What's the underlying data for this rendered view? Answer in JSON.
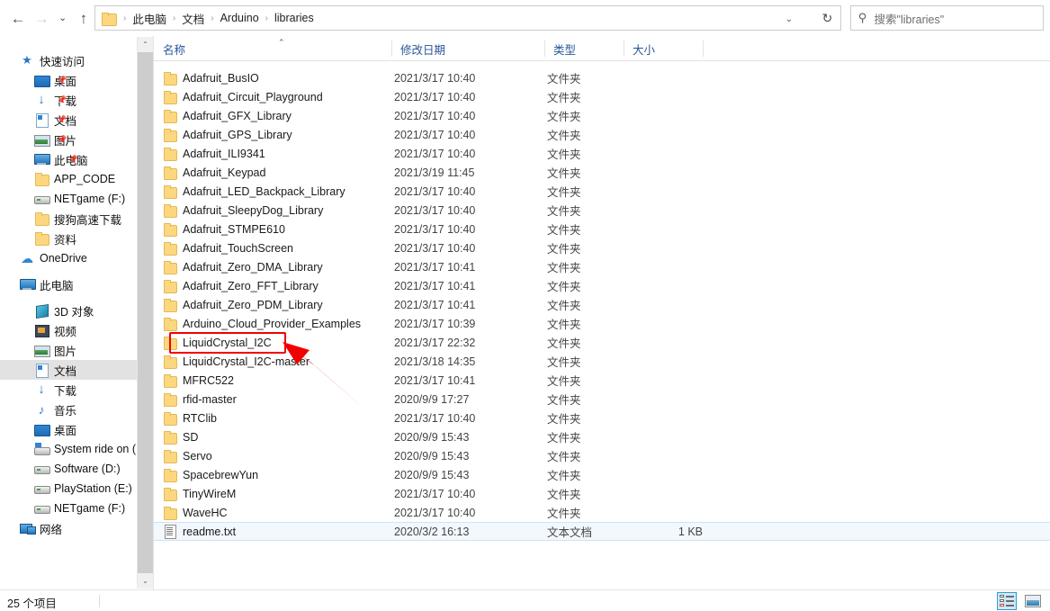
{
  "window": {
    "title": "libraries"
  },
  "nav": {
    "back_label": "←",
    "forward_label": "→",
    "recent_label": "⌄",
    "up_label": "↑"
  },
  "address": {
    "folder_icon": "folder-icon",
    "crumbs": [
      "此电脑",
      "文档",
      "Arduino",
      "libraries"
    ],
    "separator": "›",
    "dropdown_label": "⌄",
    "refresh_label": "↻"
  },
  "search": {
    "icon": "search-icon",
    "placeholder": "搜索\"libraries\""
  },
  "sidebar": {
    "items": [
      {
        "label": "快速访问",
        "icon": "star-icon",
        "level": 1,
        "pinned": false,
        "selected": false
      },
      {
        "label": "桌面",
        "icon": "desktop-icon",
        "level": 2,
        "pinned": true,
        "selected": false
      },
      {
        "label": "下载",
        "icon": "download-icon",
        "level": 2,
        "pinned": true,
        "selected": false
      },
      {
        "label": "文档",
        "icon": "document-icon",
        "level": 2,
        "pinned": true,
        "selected": false
      },
      {
        "label": "图片",
        "icon": "picture-icon",
        "level": 2,
        "pinned": true,
        "selected": false
      },
      {
        "label": "此电脑",
        "icon": "pc-icon",
        "level": 2,
        "pinned": true,
        "selected": false
      },
      {
        "label": "APP_CODE",
        "icon": "folder-icon",
        "level": 2,
        "pinned": false,
        "selected": false
      },
      {
        "label": "NETgame (F:)",
        "icon": "drive-icon",
        "level": 2,
        "pinned": false,
        "selected": false
      },
      {
        "label": "搜狗高速下载",
        "icon": "folder-icon",
        "level": 2,
        "pinned": false,
        "selected": false
      },
      {
        "label": "资料",
        "icon": "folder-icon",
        "level": 2,
        "pinned": false,
        "selected": false
      },
      {
        "label": "OneDrive",
        "icon": "onedrive-icon",
        "level": 1,
        "pinned": false,
        "selected": false
      },
      {
        "label": "此电脑",
        "icon": "pc-icon",
        "level": 1,
        "pinned": false,
        "selected": false
      },
      {
        "label": "3D 对象",
        "icon": "3d-object-icon",
        "level": 2,
        "pinned": false,
        "selected": false
      },
      {
        "label": "视频",
        "icon": "video-icon",
        "level": 2,
        "pinned": false,
        "selected": false
      },
      {
        "label": "图片",
        "icon": "picture-icon",
        "level": 2,
        "pinned": false,
        "selected": false
      },
      {
        "label": "文档",
        "icon": "document-icon",
        "level": 2,
        "pinned": false,
        "selected": true
      },
      {
        "label": "下载",
        "icon": "download-icon",
        "level": 2,
        "pinned": false,
        "selected": false
      },
      {
        "label": "音乐",
        "icon": "music-icon",
        "level": 2,
        "pinned": false,
        "selected": false
      },
      {
        "label": "桌面",
        "icon": "desktop-icon",
        "level": 2,
        "pinned": false,
        "selected": false
      },
      {
        "label": "System ride on (",
        "icon": "system-drive-icon",
        "level": 2,
        "pinned": false,
        "selected": false
      },
      {
        "label": "Software (D:)",
        "icon": "drive-icon",
        "level": 2,
        "pinned": false,
        "selected": false
      },
      {
        "label": "PlayStation (E:)",
        "icon": "drive-icon",
        "level": 2,
        "pinned": false,
        "selected": false
      },
      {
        "label": "NETgame (F:)",
        "icon": "drive-icon",
        "level": 2,
        "pinned": false,
        "selected": false
      },
      {
        "label": "网络",
        "icon": "network-icon",
        "level": 1,
        "pinned": false,
        "selected": false
      }
    ],
    "scroll_up": "⌃",
    "scroll_down": "⌄"
  },
  "filelist": {
    "columns": [
      {
        "label": "名称",
        "key": "name"
      },
      {
        "label": "修改日期",
        "key": "date"
      },
      {
        "label": "类型",
        "key": "type"
      },
      {
        "label": "大小",
        "key": "size"
      }
    ],
    "sort_indicator": "⌃",
    "sort_column": "名称",
    "sort_direction": "ascending",
    "rows": [
      {
        "name": "Adafruit_BusIO",
        "date": "2021/3/17 10:40",
        "type": "文件夹",
        "size": "",
        "icon": "folder-icon",
        "selected": false
      },
      {
        "name": "Adafruit_Circuit_Playground",
        "date": "2021/3/17 10:40",
        "type": "文件夹",
        "size": "",
        "icon": "folder-icon",
        "selected": false
      },
      {
        "name": "Adafruit_GFX_Library",
        "date": "2021/3/17 10:40",
        "type": "文件夹",
        "size": "",
        "icon": "folder-icon",
        "selected": false
      },
      {
        "name": "Adafruit_GPS_Library",
        "date": "2021/3/17 10:40",
        "type": "文件夹",
        "size": "",
        "icon": "folder-icon",
        "selected": false
      },
      {
        "name": "Adafruit_ILI9341",
        "date": "2021/3/17 10:40",
        "type": "文件夹",
        "size": "",
        "icon": "folder-icon",
        "selected": false
      },
      {
        "name": "Adafruit_Keypad",
        "date": "2021/3/19 11:45",
        "type": "文件夹",
        "size": "",
        "icon": "folder-icon",
        "selected": false
      },
      {
        "name": "Adafruit_LED_Backpack_Library",
        "date": "2021/3/17 10:40",
        "type": "文件夹",
        "size": "",
        "icon": "folder-icon",
        "selected": false
      },
      {
        "name": "Adafruit_SleepyDog_Library",
        "date": "2021/3/17 10:40",
        "type": "文件夹",
        "size": "",
        "icon": "folder-icon",
        "selected": false
      },
      {
        "name": "Adafruit_STMPE610",
        "date": "2021/3/17 10:40",
        "type": "文件夹",
        "size": "",
        "icon": "folder-icon",
        "selected": false
      },
      {
        "name": "Adafruit_TouchScreen",
        "date": "2021/3/17 10:40",
        "type": "文件夹",
        "size": "",
        "icon": "folder-icon",
        "selected": false
      },
      {
        "name": "Adafruit_Zero_DMA_Library",
        "date": "2021/3/17 10:41",
        "type": "文件夹",
        "size": "",
        "icon": "folder-icon",
        "selected": false
      },
      {
        "name": "Adafruit_Zero_FFT_Library",
        "date": "2021/3/17 10:41",
        "type": "文件夹",
        "size": "",
        "icon": "folder-icon",
        "selected": false
      },
      {
        "name": "Adafruit_Zero_PDM_Library",
        "date": "2021/3/17 10:41",
        "type": "文件夹",
        "size": "",
        "icon": "folder-icon",
        "selected": false
      },
      {
        "name": "Arduino_Cloud_Provider_Examples",
        "date": "2021/3/17 10:39",
        "type": "文件夹",
        "size": "",
        "icon": "folder-icon",
        "selected": false
      },
      {
        "name": "LiquidCrystal_I2C",
        "date": "2021/3/17 22:32",
        "type": "文件夹",
        "size": "",
        "icon": "folder-icon",
        "selected": false
      },
      {
        "name": "LiquidCrystal_I2C-master",
        "date": "2021/3/18 14:35",
        "type": "文件夹",
        "size": "",
        "icon": "folder-icon",
        "selected": false
      },
      {
        "name": "MFRC522",
        "date": "2021/3/17 10:41",
        "type": "文件夹",
        "size": "",
        "icon": "folder-icon",
        "selected": false
      },
      {
        "name": "rfid-master",
        "date": "2020/9/9 17:27",
        "type": "文件夹",
        "size": "",
        "icon": "folder-icon",
        "selected": false
      },
      {
        "name": "RTClib",
        "date": "2021/3/17 10:40",
        "type": "文件夹",
        "size": "",
        "icon": "folder-icon",
        "selected": false
      },
      {
        "name": "SD",
        "date": "2020/9/9 15:43",
        "type": "文件夹",
        "size": "",
        "icon": "folder-icon",
        "selected": false
      },
      {
        "name": "Servo",
        "date": "2020/9/9 15:43",
        "type": "文件夹",
        "size": "",
        "icon": "folder-icon",
        "selected": false
      },
      {
        "name": "SpacebrewYun",
        "date": "2020/9/9 15:43",
        "type": "文件夹",
        "size": "",
        "icon": "folder-icon",
        "selected": false
      },
      {
        "name": "TinyWireM",
        "date": "2021/3/17 10:40",
        "type": "文件夹",
        "size": "",
        "icon": "folder-icon",
        "selected": false
      },
      {
        "name": "WaveHC",
        "date": "2021/3/17 10:40",
        "type": "文件夹",
        "size": "",
        "icon": "folder-icon",
        "selected": false
      },
      {
        "name": "readme.txt",
        "date": "2020/3/2 16:13",
        "type": "文本文档",
        "size": "1 KB",
        "icon": "text-file-icon",
        "selected": true
      }
    ]
  },
  "status": {
    "item_count": "25 个项目",
    "view_details_icon": "details-view-icon",
    "view_icons_icon": "large-icons-view-icon",
    "active_view": "details"
  },
  "annotation": {
    "highlight_target": "LiquidCrystal_I2C",
    "box_color": "#f10000",
    "arrow_color": "#f10000"
  }
}
